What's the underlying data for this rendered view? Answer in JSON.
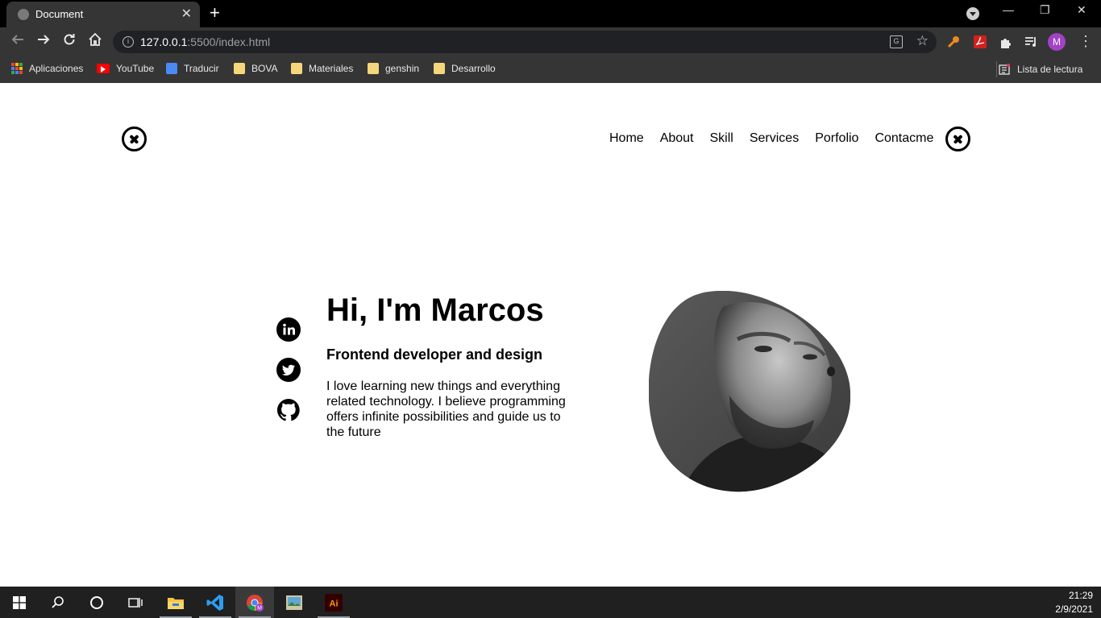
{
  "browser": {
    "tab_title": "Document",
    "tab_close": "✕",
    "new_tab": "+",
    "url_host": "127.0.0.1",
    "url_path": ":5500/index.html",
    "avatar_letter": "M",
    "window_controls": [
      "—",
      "❐",
      "✕"
    ],
    "bookmarks": [
      {
        "label": "Aplicaciones",
        "icon": "apps-grid-icon"
      },
      {
        "label": "YouTube",
        "icon": "youtube-icon"
      },
      {
        "label": "Traducir",
        "icon": "google-translate-icon"
      },
      {
        "label": "BOVA",
        "icon": "folder-icon"
      },
      {
        "label": "Materiales",
        "icon": "folder-icon"
      },
      {
        "label": "genshin",
        "icon": "folder-icon"
      },
      {
        "label": "Desarrollo",
        "icon": "folder-icon"
      }
    ],
    "reading_list": "Lista de lectura"
  },
  "nav": {
    "links": [
      "Home",
      "About",
      "Skill",
      "Services",
      "Porfolio",
      "Contacme"
    ]
  },
  "hero": {
    "title": "Hi, I'm Marcos",
    "subtitle": "Frontend developer and design",
    "description": "I love learning new things and everything related technology. I believe programming offers infinite possibilities and guide us to the future",
    "social": [
      "linkedin-icon",
      "twitter-icon",
      "github-icon"
    ]
  },
  "taskbar": {
    "time": "21:29",
    "date": "2/9/2021",
    "apps": [
      "windows-start-icon",
      "search-icon",
      "cortana-icon",
      "task-view-icon",
      "file-explorer-icon",
      "vscode-icon",
      "chrome-icon",
      "photos-icon",
      "illustrator-icon"
    ],
    "illustrator_label": "Ai",
    "chrome_badge": "M"
  },
  "colors": {
    "chrome_bg": "#353535",
    "tabbar_bg": "#000000",
    "taskbar_bg": "#202020",
    "avatar": "#a342c6",
    "text": "#000000"
  }
}
